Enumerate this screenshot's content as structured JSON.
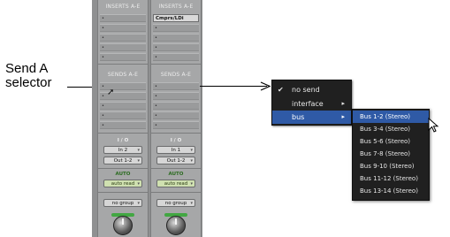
{
  "callout": {
    "line1": "Send A",
    "line2": "selector"
  },
  "strips": [
    {
      "inserts_header": "INSERTS A-E",
      "insert_slots": [
        "•",
        "•",
        "•",
        "•",
        "•"
      ],
      "sends_header": "SENDS A-E",
      "send_slots": [
        "•",
        "•",
        "•",
        "•",
        "•"
      ],
      "io_label": "I / O",
      "input": "In 2",
      "output": "Out 1-2",
      "auto_label": "AUTO",
      "auto_mode": "auto read",
      "group": "no group"
    },
    {
      "inserts_header": "INSERTS A-E",
      "insert_slots": [
        "Cmprs/LDi",
        "•",
        "•",
        "•",
        "•"
      ],
      "sends_header": "SENDS A-E",
      "send_slots": [
        "•",
        "•",
        "•",
        "•",
        "•"
      ],
      "io_label": "I / O",
      "input": "In 1",
      "output": "Out 1-2",
      "auto_label": "AUTO",
      "auto_mode": "auto read",
      "group": "no group"
    }
  ],
  "send_menu": {
    "items": [
      {
        "label": "no send",
        "checked": true,
        "submenu": false,
        "selected": false
      },
      {
        "label": "interface",
        "checked": false,
        "submenu": true,
        "selected": false
      },
      {
        "label": "bus",
        "checked": false,
        "submenu": true,
        "selected": true
      }
    ],
    "check_glyph": "✔",
    "submenu_glyph": "▸"
  },
  "bus_submenu": {
    "items": [
      {
        "label": "Bus 1-2 (Stereo)",
        "selected": true
      },
      {
        "label": "Bus 3-4 (Stereo)",
        "selected": false
      },
      {
        "label": "Bus 5-6 (Stereo)",
        "selected": false
      },
      {
        "label": "Bus 7-8 (Stereo)",
        "selected": false
      },
      {
        "label": "Bus 9-10 (Stereo)",
        "selected": false
      },
      {
        "label": "Bus 11-12 (Stereo)",
        "selected": false
      },
      {
        "label": "Bus 13-14 (Stereo)",
        "selected": false
      }
    ]
  },
  "colors": {
    "menu_bg": "#202020",
    "menu_highlight": "#2f5aa6",
    "strip_bg": "#a6a7a8",
    "knob_ring": "#42a742"
  }
}
